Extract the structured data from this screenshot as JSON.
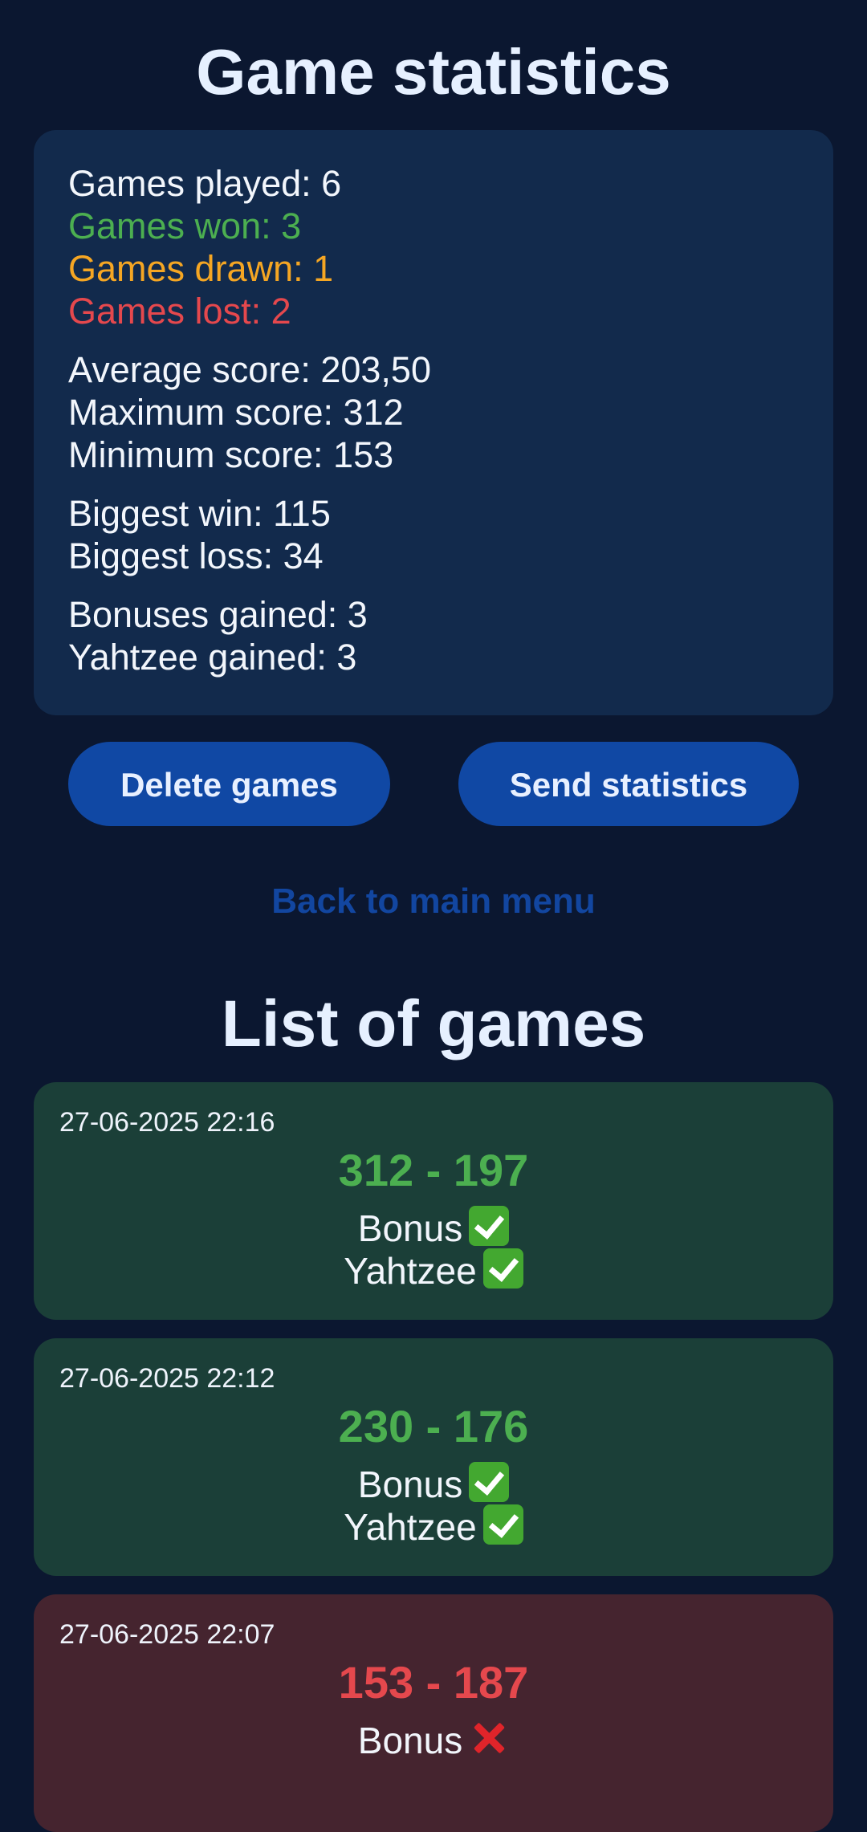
{
  "header": {
    "title": "Game statistics"
  },
  "stats": {
    "games_played": "Games played: 6",
    "games_won": "Games won: 3",
    "games_drawn": "Games drawn: 1",
    "games_lost": "Games lost: 2",
    "average_score": "Average score: 203,50",
    "maximum_score": "Maximum score: 312",
    "minimum_score": "Minimum score: 153",
    "biggest_win": "Biggest win: 115",
    "biggest_loss": "Biggest loss: 34",
    "bonuses_gained": "Bonuses gained: 3",
    "yahtzee_gained": "Yahtzee gained: 3"
  },
  "actions": {
    "delete_label": "Delete games",
    "send_label": "Send statistics",
    "back_label": "Back to main menu"
  },
  "games_list": {
    "title": "List of games",
    "games": [
      {
        "date": "27-06-2025 22:16",
        "score": "312 - 197",
        "result": "win",
        "bonus_label": "Bonus",
        "bonus": true,
        "yahtzee_label": "Yahtzee",
        "yahtzee": true
      },
      {
        "date": "27-06-2025 22:12",
        "score": "230 - 176",
        "result": "win",
        "bonus_label": "Bonus",
        "bonus": true,
        "yahtzee_label": "Yahtzee",
        "yahtzee": true
      },
      {
        "date": "27-06-2025 22:07",
        "score": "153 - 187",
        "result": "loss",
        "bonus_label": "Bonus",
        "bonus": false
      }
    ]
  },
  "colors": {
    "background": "#0b1730",
    "panel": "#122a4c",
    "button": "#1048a4",
    "won": "#4caf50",
    "drawn": "#f5a623",
    "lost": "#e5484d",
    "win_card": "#1b3f38",
    "loss_card": "#45242f"
  },
  "icons": {
    "yes": "check-mark-icon",
    "no": "cross-mark-icon"
  }
}
